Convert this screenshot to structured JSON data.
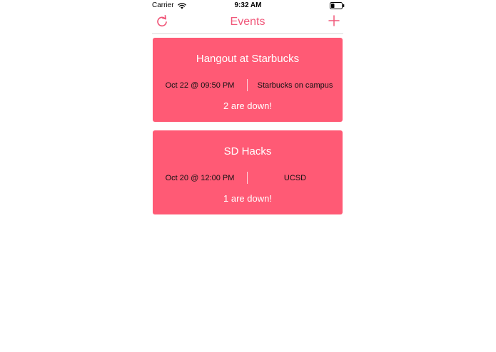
{
  "status_bar": {
    "carrier": "Carrier",
    "time": "9:32 AM",
    "wifi_icon": "wifi-icon",
    "battery_icon": "battery-icon"
  },
  "nav": {
    "title": "Events",
    "refresh_icon": "refresh-icon",
    "add_icon": "plus-icon"
  },
  "colors": {
    "accent": "#f0587a",
    "card_background": "#ff5a75",
    "card_text": "#ffffff",
    "meta_text": "#111111"
  },
  "events": [
    {
      "title": "Hangout at Starbucks",
      "date": "Oct 22 @ 09:50 PM",
      "location": "Starbucks on campus",
      "attendees": "2 are down!"
    },
    {
      "title": "SD Hacks",
      "date": "Oct 20 @ 12:00 PM",
      "location": "UCSD",
      "attendees": "1 are down!"
    }
  ]
}
